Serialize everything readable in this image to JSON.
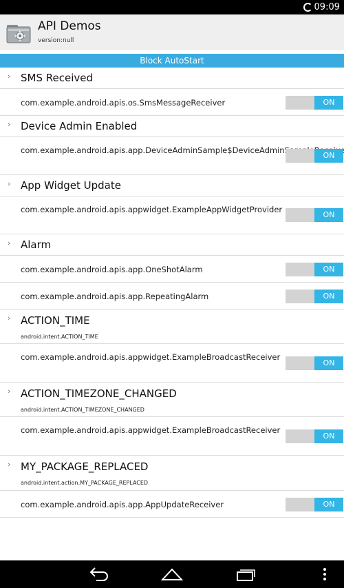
{
  "status_bar": {
    "time": "09:09",
    "icons": [
      "sync-spinner-icon"
    ]
  },
  "app_bar": {
    "title": "API Demos",
    "subtitle": "version:null",
    "icon": "app-folder-gear-icon"
  },
  "block_button": {
    "label": "Block AutoStart",
    "color": "#3aabdf"
  },
  "toggle_colors": {
    "on": "#33b5e5",
    "off_track": "#d3d3d3"
  },
  "groups": [
    {
      "title": "SMS Received",
      "subtitle": "",
      "receivers": [
        {
          "name": "com.example.android.apis.os.SmsMessageReceiver",
          "state": "ON"
        }
      ]
    },
    {
      "title": "Device Admin Enabled",
      "subtitle": "",
      "receivers": [
        {
          "name": "com.example.android.apis.app.DeviceAdminSample$DeviceAdminSampleReceiver",
          "state": "ON"
        }
      ]
    },
    {
      "title": "App Widget Update",
      "subtitle": "",
      "receivers": [
        {
          "name": "com.example.android.apis.appwidget.ExampleAppWidgetProvider",
          "state": "ON"
        }
      ]
    },
    {
      "title": "Alarm",
      "subtitle": "",
      "receivers": [
        {
          "name": "com.example.android.apis.app.OneShotAlarm",
          "state": "ON"
        },
        {
          "name": "com.example.android.apis.app.RepeatingAlarm",
          "state": "ON"
        }
      ]
    },
    {
      "title": "ACTION_TIME",
      "subtitle": "android.intent.ACTION_TIME",
      "receivers": [
        {
          "name": "com.example.android.apis.appwidget.ExampleBroadcastReceiver",
          "state": "ON"
        }
      ]
    },
    {
      "title": "ACTION_TIMEZONE_CHANGED",
      "subtitle": "android.intent.ACTION_TIMEZONE_CHANGED",
      "receivers": [
        {
          "name": "com.example.android.apis.appwidget.ExampleBroadcastReceiver",
          "state": "ON"
        }
      ]
    },
    {
      "title": "MY_PACKAGE_REPLACED",
      "subtitle": "android.intent.action.MY_PACKAGE_REPLACED",
      "receivers": [
        {
          "name": "com.example.android.apis.app.AppUpdateReceiver",
          "state": "ON"
        }
      ]
    }
  ],
  "nav_bar": {
    "icons": [
      "back-icon",
      "home-icon",
      "recents-icon",
      "menu-overflow-icon"
    ]
  }
}
